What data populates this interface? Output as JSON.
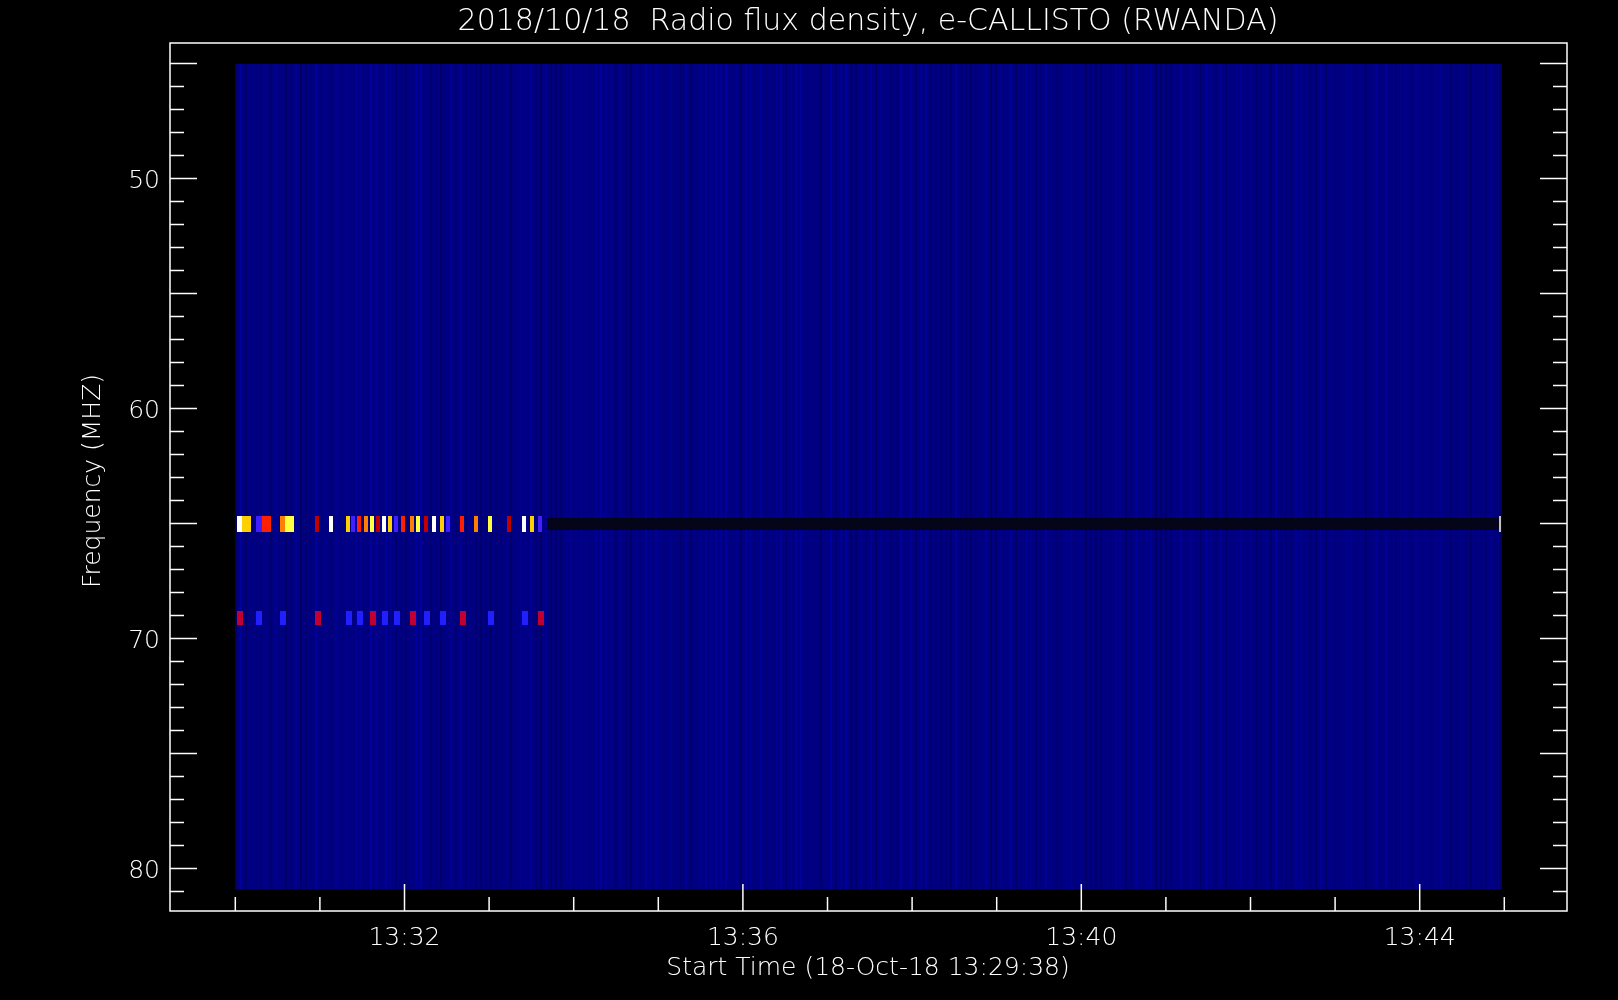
{
  "title": "2018/10/18  Radio flux density, e-CALLISTO (RWANDA)",
  "y_axis": {
    "label": "Frequency (MHZ)",
    "ticks": [
      "50",
      "60",
      "70",
      "80"
    ]
  },
  "x_axis": {
    "label": "Start Time (18-Oct-18 13:29:38)",
    "ticks": [
      "13:32",
      "13:36",
      "13:40",
      "13:44"
    ]
  }
}
